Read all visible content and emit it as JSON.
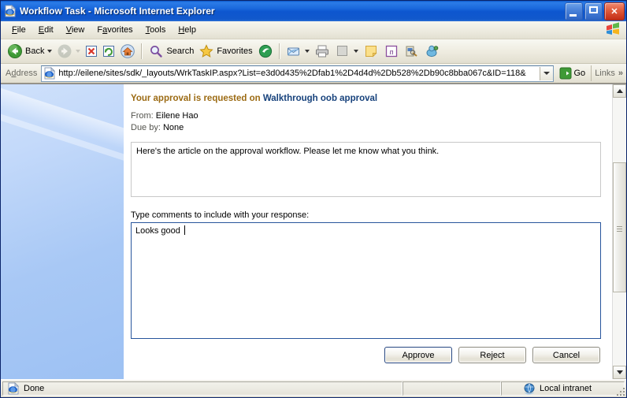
{
  "window": {
    "title": "Workflow Task - Microsoft Internet Explorer",
    "icon": "ie-document-icon",
    "minimize_label": "Minimize",
    "maximize_label": "Maximize",
    "close_label": "Close"
  },
  "menu": {
    "items": [
      {
        "label": "File",
        "accel": "F"
      },
      {
        "label": "Edit",
        "accel": "E"
      },
      {
        "label": "View",
        "accel": "V"
      },
      {
        "label": "Favorites",
        "accel": "a"
      },
      {
        "label": "Tools",
        "accel": "T"
      },
      {
        "label": "Help",
        "accel": "H"
      }
    ],
    "brand_icon": "windows-flag-icon"
  },
  "toolbar": {
    "back_label": "Back",
    "back_icon": "back-arrow-icon",
    "forward_icon": "forward-arrow-icon",
    "stop_icon": "stop-icon",
    "refresh_icon": "refresh-icon",
    "home_icon": "home-icon",
    "search_label": "Search",
    "search_icon": "search-icon",
    "favorites_label": "Favorites",
    "favorites_icon": "star-icon",
    "media_icon": "media-icon",
    "mail_icon": "mail-icon",
    "print_icon": "print-icon",
    "edit_icon": "edit-page-icon",
    "notes_icon": "sticky-note-icon",
    "onenote_icon": "onenote-icon",
    "research_icon": "research-icon",
    "messenger_icon": "messenger-icon"
  },
  "address": {
    "label": "Address",
    "icon": "ie-document-icon",
    "url": "http://eilene/sites/sdk/_layouts/WrkTaskIP.aspx?List=e3d0d435%2Dfab1%2D4d4d%2Db528%2Db90c8bba067c&ID=118&",
    "dropdown_icon": "chevron-down-icon",
    "go_label": "Go",
    "go_icon": "go-arrow-icon",
    "links_label": "Links",
    "links_chevron": "»"
  },
  "form": {
    "heading_prefix": "Your approval is requested on ",
    "heading_document": "Walkthrough oob approval",
    "from_label": "From:",
    "from_value": "Eilene Hao",
    "due_label": "Due by:",
    "due_value": "None",
    "message_text": "Here's the article on the approval workflow.  Please let me know what you think.",
    "comments_label": "Type comments to include with your response:",
    "comments_value": "Looks good ",
    "buttons": [
      {
        "label": "Approve",
        "name": "approve-button",
        "default": true
      },
      {
        "label": "Reject",
        "name": "reject-button",
        "default": false
      },
      {
        "label": "Cancel",
        "name": "cancel-button",
        "default": false
      }
    ]
  },
  "scrollbar": {
    "up_icon": "scroll-up-icon",
    "down_icon": "scroll-down-icon"
  },
  "statusbar": {
    "status_text": "Done",
    "status_icon": "ie-document-icon",
    "zone_text": "Local intranet",
    "zone_icon": "globe-icon"
  },
  "colors": {
    "title_gradient_start": "#2b7ce8",
    "title_gradient_end": "#0d56cf",
    "heading_color": "#9c6b14",
    "link_color": "#17427c",
    "sidebar_top": "#cfe1fb",
    "sidebar_bottom": "#9dc1f3",
    "focus_border": "#28559c"
  }
}
